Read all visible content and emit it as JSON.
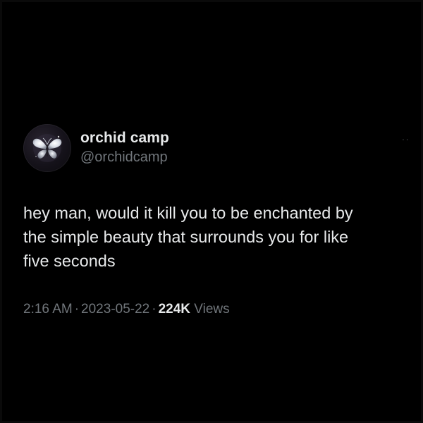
{
  "tweet": {
    "author": {
      "display_name": "orchid camp",
      "handle": "@orchidcamp",
      "avatar_icon": "butterfly-icon"
    },
    "more_icon": "more-options-icon",
    "more_glyph": "··",
    "text": "hey man, would it kill you to be enchanted by\nthe simple beauty that surrounds you for like\nfive seconds",
    "time": "2:16 AM",
    "date": "2023-05-22",
    "separator": "·",
    "views_count": "224K",
    "views_label": "Views"
  },
  "colors": {
    "background": "#000000",
    "primary_text": "#e7e9ea",
    "secondary_text": "#71767b"
  }
}
